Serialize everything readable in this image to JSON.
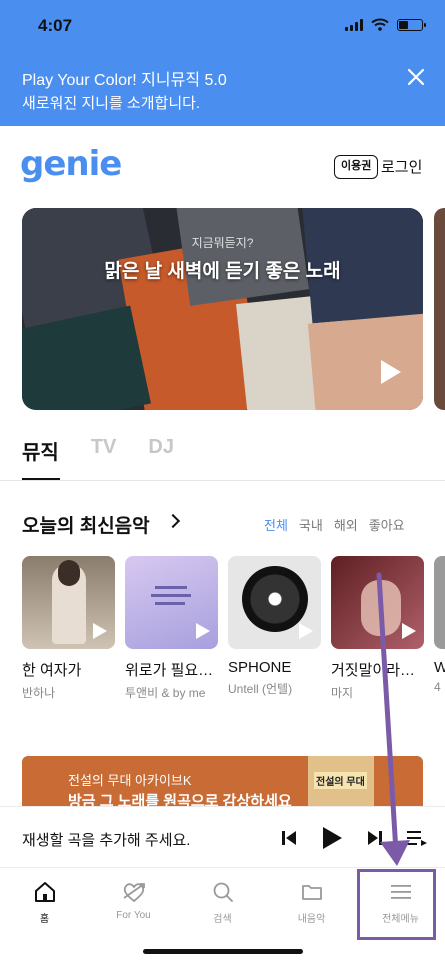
{
  "status_bar": {
    "time": "4:07"
  },
  "promo": {
    "line1": "Play Your Color! 지니뮤직 5.0",
    "line2": "새로워진 지니를 소개합니다.",
    "close_icon": "close-icon"
  },
  "header": {
    "logo": "genie",
    "pass_label": "이용권",
    "login_label": "로그인"
  },
  "banner": {
    "subtitle": "지금뭐듣지?",
    "title": "맑은 날 새벽에 듣기 좋은 노래"
  },
  "tabs": [
    {
      "label": "뮤직",
      "active": true
    },
    {
      "label": "TV",
      "active": false
    },
    {
      "label": "DJ",
      "active": false
    }
  ],
  "section": {
    "title": "오늘의 최신음악",
    "filters": [
      {
        "label": "전체",
        "active": true
      },
      {
        "label": "국내",
        "active": false
      },
      {
        "label": "해외",
        "active": false
      },
      {
        "label": "좋아요",
        "active": false
      }
    ]
  },
  "albums": [
    {
      "title": "한 여자가",
      "artist": "반하나",
      "color": "#b9a99a"
    },
    {
      "title": "위로가 필요…",
      "artist": "투앤비 & by me",
      "color": "#b7b2e6"
    },
    {
      "title": "SPHONE",
      "artist": "Untell (언텔)",
      "color": "#d8d8d8"
    },
    {
      "title": "거짓말이라도…",
      "artist": "마지",
      "color": "#8a3f3a"
    },
    {
      "title": "W",
      "artist": "4",
      "color": "#9a9a9a"
    }
  ],
  "ad": {
    "line1": "전설의 무대 아카이브K",
    "line2": "방금 그 노래를 원곡으로 감상하세요",
    "thumb_label": "전설의 무대"
  },
  "player": {
    "empty_text": "재생할 곡을 추가해 주세요."
  },
  "bottom_nav": [
    {
      "label": "홈",
      "icon": "home-icon",
      "active": true
    },
    {
      "label": "For You",
      "icon": "heart-arrow-icon",
      "active": false
    },
    {
      "label": "검색",
      "icon": "search-icon",
      "active": false
    },
    {
      "label": "내음악",
      "icon": "folder-icon",
      "active": false
    },
    {
      "label": "전체메뉴",
      "icon": "menu-icon",
      "active": false
    }
  ],
  "colors": {
    "brand": "#4a8ff0",
    "annotation": "#7b5ba8"
  }
}
